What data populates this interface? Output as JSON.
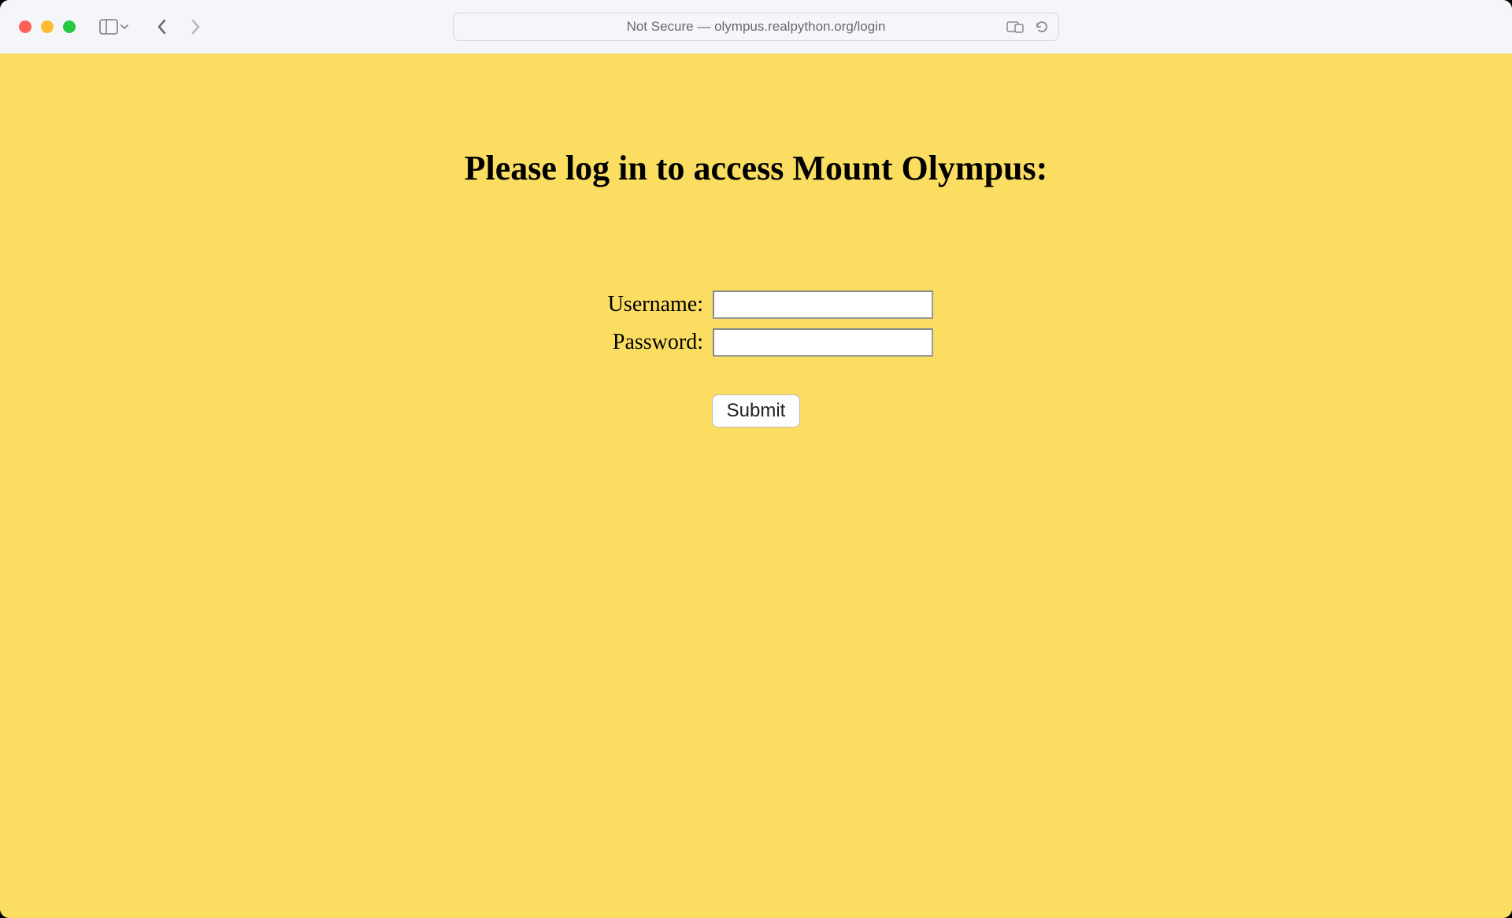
{
  "browser": {
    "address_text": "Not Secure — olympus.realpython.org/login"
  },
  "page": {
    "heading": "Please log in to access Mount Olympus:",
    "form": {
      "username_label": "Username:",
      "username_value": "",
      "password_label": "Password:",
      "password_value": "",
      "submit_label": "Submit"
    }
  }
}
